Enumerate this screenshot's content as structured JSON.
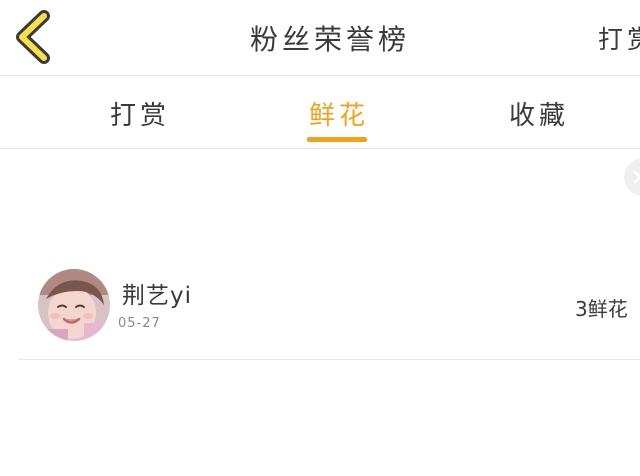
{
  "header": {
    "title": "粉丝荣誉榜",
    "right_link": "打赏"
  },
  "tabs": [
    {
      "label": "打赏",
      "active": false
    },
    {
      "label": "鲜花",
      "active": true
    },
    {
      "label": "收藏",
      "active": false
    }
  ],
  "colors": {
    "accent": "#f2a31c",
    "back_arrow": "#f7e04a"
  },
  "icons": {
    "back": "chevron-left-icon",
    "close": "close-icon"
  },
  "fans": [
    {
      "name": "荆艺yi",
      "date": "05-27",
      "count": "3鲜花"
    }
  ]
}
